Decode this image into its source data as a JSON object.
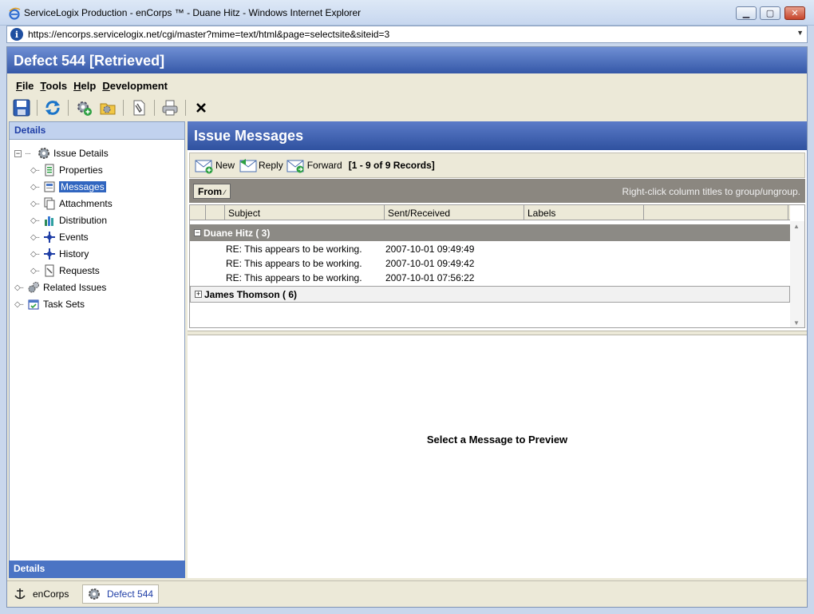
{
  "window": {
    "title": "ServiceLogix Production - enCorps ™ - Duane Hitz - Windows Internet Explorer",
    "url": "https://encorps.servicelogix.net/cgi/master?mime=text/html&page=selectsite&siteid=3"
  },
  "app": {
    "title": "Defect 544 [Retrieved]",
    "menu": [
      "File",
      "Tools",
      "Help",
      "Development"
    ],
    "toolbar_icons": [
      "save-icon",
      "refresh-icon",
      "settings-add-icon",
      "folder-settings-icon",
      "attach-document-icon",
      "print-icon",
      "close-x-icon"
    ]
  },
  "left_panel": {
    "header": "Details",
    "footer": "Details",
    "tree": [
      {
        "label": "Issue Details",
        "level": 0,
        "icon": "gear-icon",
        "expander": "-"
      },
      {
        "label": "Properties",
        "level": 1,
        "icon": "properties-icon"
      },
      {
        "label": "Messages",
        "level": 1,
        "icon": "messages-icon",
        "selected": true
      },
      {
        "label": "Attachments",
        "level": 1,
        "icon": "attachments-icon"
      },
      {
        "label": "Distribution",
        "level": 1,
        "icon": "distribution-icon"
      },
      {
        "label": "Events",
        "level": 1,
        "icon": "events-icon"
      },
      {
        "label": "History",
        "level": 1,
        "icon": "history-icon"
      },
      {
        "label": "Requests",
        "level": 1,
        "icon": "requests-icon"
      },
      {
        "label": "Related Issues",
        "level": 0,
        "icon": "related-issues-icon"
      },
      {
        "label": "Task Sets",
        "level": 0,
        "icon": "task-sets-icon"
      }
    ]
  },
  "messages": {
    "header": "Issue Messages",
    "buttons": {
      "new": "New",
      "reply": "Reply",
      "forward": "Forward"
    },
    "records": "[1 - 9 of 9 Records]",
    "group_by": "From",
    "group_hint": "Right-click column titles to group/ungroup.",
    "columns": [
      "Subject",
      "Sent/Received",
      "Labels"
    ],
    "groups": [
      {
        "name": "Duane Hitz ( 3)",
        "expanded": true,
        "rows": [
          {
            "subject": "RE: This appears to be working.",
            "date": "2007-10-01 09:49:49"
          },
          {
            "subject": "RE: This appears to be working.",
            "date": "2007-10-01 09:49:42"
          },
          {
            "subject": "RE: This appears to be working.",
            "date": "2007-10-01 07:56:22"
          }
        ]
      },
      {
        "name": "James Thomson ( 6)",
        "expanded": false,
        "rows": []
      }
    ],
    "preview_text": "Select a Message to Preview"
  },
  "taskbar": [
    {
      "label": "enCorps",
      "icon": "anchor-icon"
    },
    {
      "label": "Defect 544",
      "icon": "gear-icon",
      "active": true
    }
  ]
}
